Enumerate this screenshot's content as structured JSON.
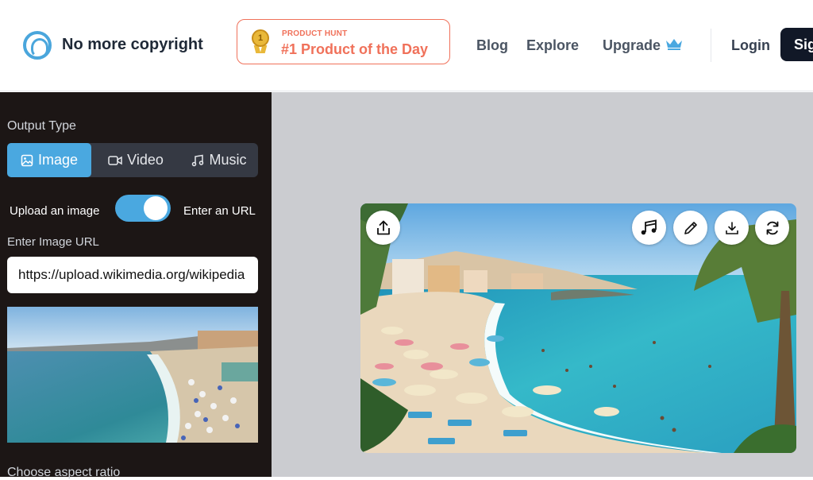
{
  "header": {
    "brand": "No more copyright",
    "product_hunt": {
      "small": "PRODUCT HUNT",
      "big": "#1 Product of the Day",
      "medal_number": "1"
    },
    "nav": {
      "blog": "Blog",
      "explore": "Explore",
      "upgrade": "Upgrade"
    },
    "login": "Login",
    "signup": "Sig"
  },
  "sidebar": {
    "output_type_label": "Output Type",
    "tabs": [
      {
        "label": "Image",
        "icon": "image-icon",
        "active": true
      },
      {
        "label": "Video",
        "icon": "video-icon",
        "active": false
      },
      {
        "label": "Music",
        "icon": "music-icon",
        "active": false
      }
    ],
    "toggle": {
      "left_label": "Upload an image",
      "right_label": "Enter an URL",
      "on": true
    },
    "url_label": "Enter Image URL",
    "url_value": "https://upload.wikimedia.org/wikipedia",
    "aspect_label": "Choose aspect ratio"
  },
  "result": {
    "actions": [
      "share-icon",
      "music-note-icon",
      "pencil-icon",
      "download-icon",
      "refresh-icon"
    ]
  },
  "colors": {
    "accent": "#4aa8e0",
    "product_hunt": "#f0715a",
    "sidebar_bg": "#1c1615",
    "main_bg": "#cbccd0"
  }
}
